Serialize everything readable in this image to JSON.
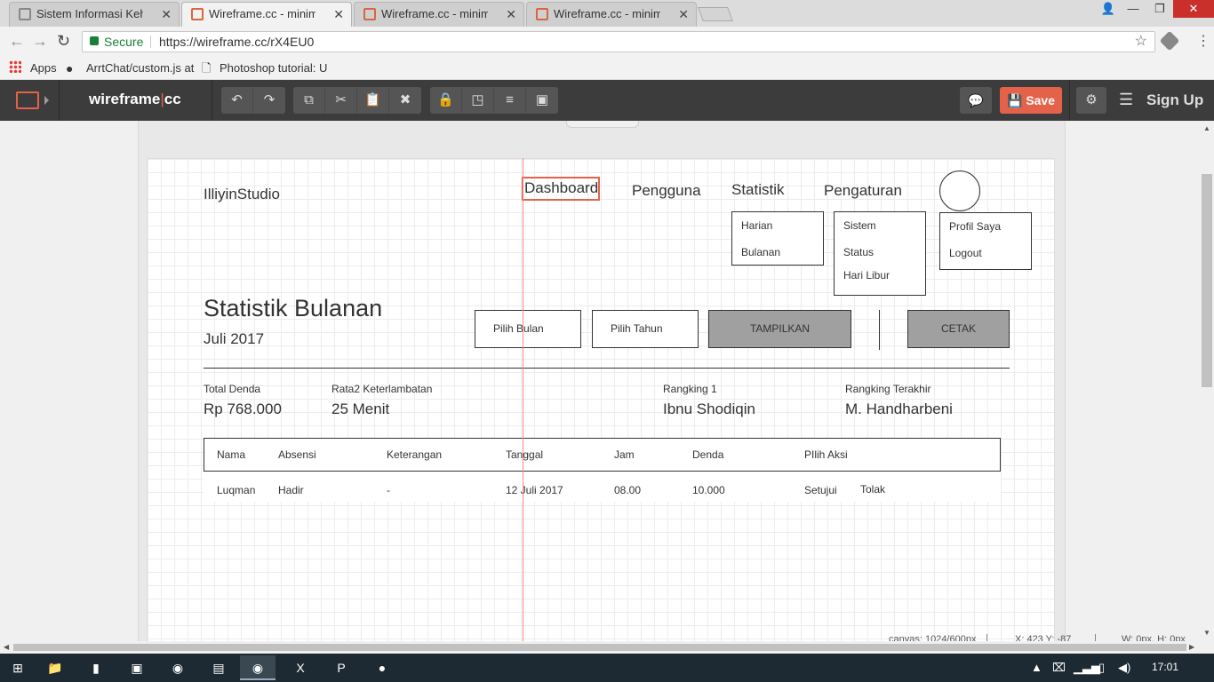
{
  "browser": {
    "tabs": [
      {
        "title": "Sistem Informasi Kehadir",
        "icon": "document-icon",
        "active": false
      },
      {
        "title": "Wireframe.cc - minimal w",
        "icon": "wireframe-icon",
        "active": true
      },
      {
        "title": "Wireframe.cc - minimal w",
        "icon": "wireframe-icon",
        "active": false
      },
      {
        "title": "Wireframe.cc - minimal w",
        "icon": "wireframe-icon",
        "active": false
      }
    ],
    "tab_close": "✕",
    "window": {
      "minimize": "—",
      "restore": "❐",
      "close": "✕",
      "user": "👤"
    },
    "address": {
      "secure_label": "Secure",
      "url": "https://wireframe.cc/rX4EU0"
    },
    "bookmarks": {
      "apps": "Apps",
      "items": [
        "ArrtChat/custom.js at",
        "Photoshop tutorial: U"
      ]
    }
  },
  "toolbar": {
    "logo_left": "wireframe",
    "logo_bar": "|",
    "logo_right": "cc",
    "save_label": "Save",
    "signup_label": "Sign Up",
    "icons": {
      "undo": "↶",
      "redo": "↷",
      "copy": "⧉",
      "cut": "✂",
      "paste": "📋",
      "delete": "✖",
      "lock": "🔒",
      "arrange": "◳",
      "align": "≡",
      "group": "▣",
      "comment": "💬",
      "save": "💾",
      "settings": "⚙",
      "menu": "☰"
    }
  },
  "wireframe": {
    "brand": "IlliyinStudio",
    "nav": [
      "Dashboard",
      "Pengguna",
      "Statistik",
      "Pengaturan"
    ],
    "statistik_menu": [
      "Harian",
      "Bulanan"
    ],
    "pengaturan_menu": [
      "Sistem",
      "Status",
      "Hari Libur"
    ],
    "profile_menu": [
      "Profil Saya",
      "Logout"
    ],
    "page_title": "Statistik Bulanan",
    "period": "Juli 2017",
    "controls": {
      "month": "Pilih Bulan",
      "year": "Pilih Tahun",
      "show": "TAMPILKAN",
      "print": "CETAK"
    },
    "stats": [
      {
        "label": "Total Denda",
        "value": "Rp 768.000"
      },
      {
        "label": "Rata2 Keterlambatan",
        "value": "25 Menit"
      },
      {
        "label": "Rangking 1",
        "value": "Ibnu Shodiqin"
      },
      {
        "label": "Rangking Terakhir",
        "value": "M. Handharbeni"
      }
    ],
    "table": {
      "headers": [
        "Nama",
        "Absensi",
        "Keterangan",
        "Tanggal",
        "Jam",
        "Denda",
        "PIlih Aksi"
      ],
      "rows": [
        {
          "nama": "Luqman",
          "absensi": "Hadir",
          "keterangan": "-",
          "tanggal": "12 Juli 2017",
          "jam": "08.00",
          "denda": "10.000",
          "aksi1": "Setujui",
          "aksi2": "Tolak"
        }
      ]
    }
  },
  "status": {
    "canvas": "canvas: 1024/600px",
    "cursor": "X: 423 Y: -87",
    "selection": "W: 0px, H: 0px"
  },
  "taskbar": {
    "clock": "17:01"
  },
  "colors": {
    "accent": "#e4624a",
    "toolbar": "#3c3c3c",
    "secure": "#1a7f37"
  }
}
